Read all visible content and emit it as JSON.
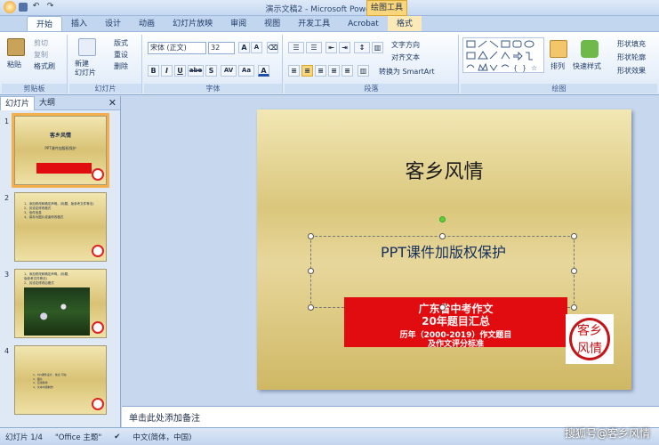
{
  "window": {
    "title": "演示文稿2 - Microsoft PowerPoint",
    "context_tab_group": "绘图工具"
  },
  "qat": {
    "save": "save-icon",
    "undo": "undo-icon",
    "redo": "redo-icon"
  },
  "tabs": [
    "开始",
    "插入",
    "设计",
    "动画",
    "幻灯片放映",
    "审阅",
    "视图",
    "开发工具",
    "Acrobat",
    "格式"
  ],
  "ribbon": {
    "clipboard": {
      "label": "剪贴板",
      "paste": "粘贴",
      "cut": "剪切",
      "copy": "复制",
      "format_painter": "格式刷"
    },
    "slides": {
      "label": "幻灯片",
      "new_slide": "新建\n幻灯片",
      "layout": "版式",
      "reset": "重设",
      "delete": "删除"
    },
    "font": {
      "label": "字体",
      "font_name": "宋体 (正文)",
      "font_size": "32",
      "bold": "B",
      "italic": "I",
      "underline": "U",
      "strike": "abe",
      "shadow": "S",
      "spacing": "AV",
      "case": "Aa",
      "color": "A"
    },
    "paragraph": {
      "label": "段落",
      "text_direction": "文字方向",
      "align_text": "对齐文本",
      "smartart": "转换为 SmartArt"
    },
    "drawing": {
      "label": "绘图",
      "arrange": "排列",
      "quick_styles": "快速样式",
      "shape_fill": "形状填充",
      "shape_outline": "形状轮廓",
      "shape_effects": "形状效果"
    }
  },
  "left_pane": {
    "tab_slides": "幻灯片",
    "tab_outline": "大纲",
    "thumbs": [
      {
        "num": "1",
        "title": "客乡风情",
        "sub": "PPT课件加版权保护"
      },
      {
        "num": "2",
        "lines": [
          "1、添加修改和确定声明。(标题、版参考文件等法)",
          "2、另设定修改格式",
          "3、信件信息",
          "4、保存为图片或者修改格式"
        ]
      },
      {
        "num": "3",
        "lines": [
          "1、添加修改和确定声明。(标题、",
          "   版参考文件等法)",
          "2、另设定修改后格式"
        ]
      },
      {
        "num": "4",
        "lines": [
          "1、Ppt课件设计、信息 可在",
          "2、图片",
          "3、应用软件",
          "4、文本内容制作"
        ]
      }
    ]
  },
  "slide": {
    "title": "客乡风情",
    "subtitle": "PPT课件加版权保护",
    "banner_line1": "广东省中考作文",
    "banner_line2": "20年题目汇总",
    "banner_line3": "历年（2000-2019）作文题目",
    "banner_line4": "及作文评分标准",
    "stamp_text": "客乡\n风情"
  },
  "notes_placeholder": "单击此处添加备注",
  "status": {
    "slide_count": "幻灯片 1/4",
    "theme": "\"Office 主题\"",
    "language": "中文(简体，中国)"
  },
  "watermark": "搜狐号@客乡风情"
}
